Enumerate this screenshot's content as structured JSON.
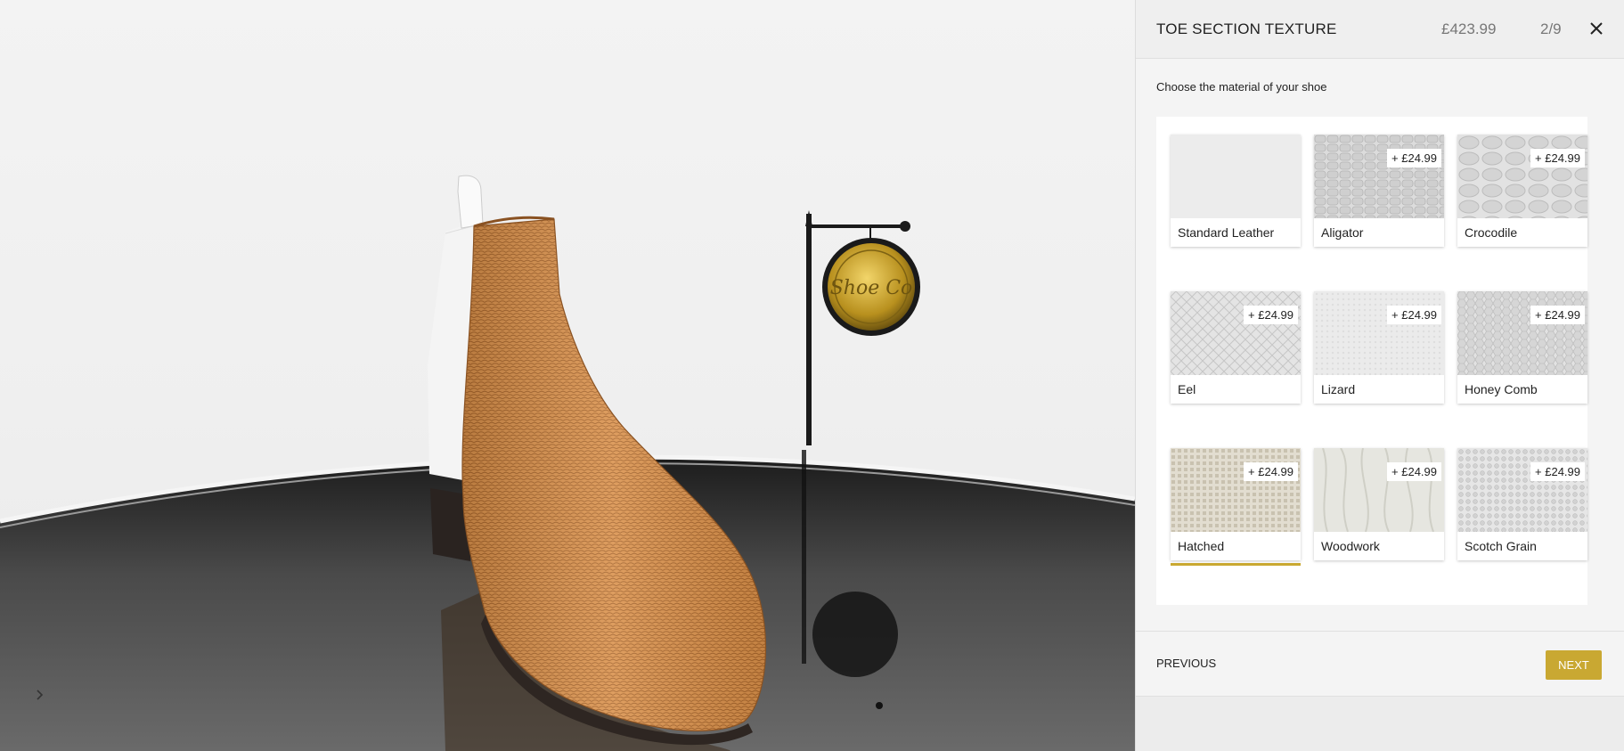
{
  "viewer": {
    "sign_text": "Shoe Co",
    "toggle_icon": "chevron-right-icon"
  },
  "panel": {
    "title": "TOE SECTION TEXTURE",
    "price": "£423.99",
    "step_counter": "2/9",
    "close_icon": "close-icon",
    "instructions": "Choose the material of your shoe",
    "materials": [
      {
        "name": "Standard Leather",
        "price": ""
      },
      {
        "name": "Aligator",
        "price": "+ £24.99"
      },
      {
        "name": "Crocodile",
        "price": "+ £24.99"
      },
      {
        "name": "Eel",
        "price": "+ £24.99"
      },
      {
        "name": "Lizard",
        "price": "+ £24.99"
      },
      {
        "name": "Honey Comb",
        "price": "+ £24.99"
      },
      {
        "name": "Hatched",
        "price": "+ £24.99"
      },
      {
        "name": "Woodwork",
        "price": "+ £24.99"
      },
      {
        "name": "Scotch Grain",
        "price": "+ £24.99"
      }
    ],
    "selected_material": "Hatched",
    "previous_label": "PREVIOUS",
    "next_label": "NEXT",
    "accent_color": "#c9a832"
  }
}
